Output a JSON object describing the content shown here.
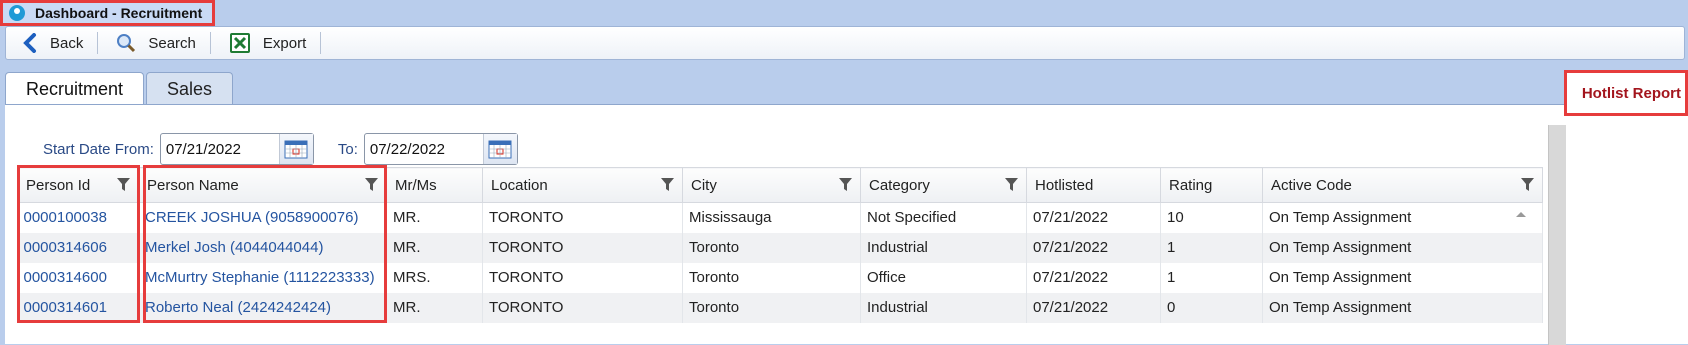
{
  "window": {
    "title": "Dashboard - Recruitment"
  },
  "toolbar": {
    "back_label": "Back",
    "search_label": "Search",
    "export_label": "Export"
  },
  "tabs": [
    {
      "label": "Recruitment"
    },
    {
      "label": "Sales"
    }
  ],
  "hotlist_report": {
    "label": "Hotlist Report"
  },
  "filters": {
    "start_label": "Start Date From:",
    "start_value": "07/21/2022",
    "to_label": "To:",
    "to_value": "07/22/2022"
  },
  "table": {
    "columns": [
      "Person Id",
      "Person Name",
      "Mr/Ms",
      "Location",
      "City",
      "Category",
      "Hotlisted",
      "Rating",
      "Active Code"
    ],
    "rows": [
      [
        "0000100038",
        "CREEK JOSHUA (9058900076)",
        "MR.",
        "TORONTO",
        "Mississauga",
        "Not Specified",
        "07/21/2022",
        "10",
        "On Temp Assignment"
      ],
      [
        "0000314606",
        "Merkel Josh (4044044044)",
        "MR.",
        "TORONTO",
        "Toronto",
        "Industrial",
        "07/21/2022",
        "1",
        "On Temp Assignment"
      ],
      [
        "0000314600",
        "McMurtry Stephanie (1112223333)",
        "MRS.",
        "TORONTO",
        "Toronto",
        "Office",
        "07/21/2022",
        "1",
        "On Temp Assignment"
      ],
      [
        "0000314601",
        "Roberto Neal (2424242424)",
        "MR.",
        "TORONTO",
        "Toronto",
        "Industrial",
        "07/21/2022",
        "0",
        "On Temp Assignment"
      ]
    ]
  },
  "colors": {
    "highlight": "#e63c3c",
    "link": "#2454a0",
    "hotlist": "#a3151d"
  }
}
